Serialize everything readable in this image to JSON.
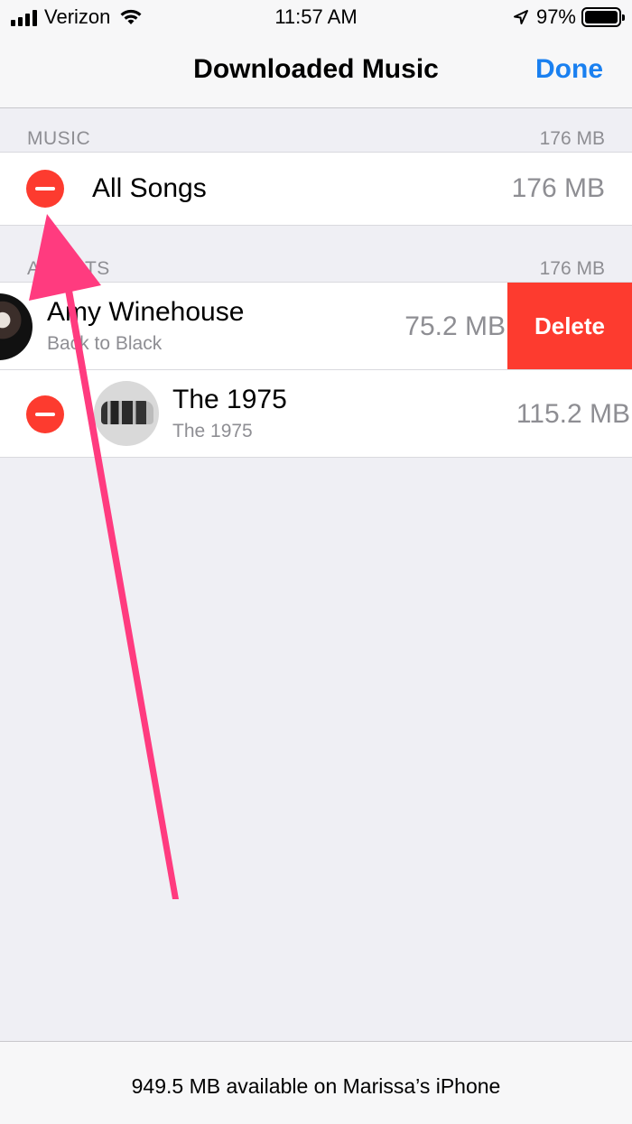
{
  "status_bar": {
    "carrier": "Verizon",
    "time": "11:57 AM",
    "battery_percent": "97%",
    "icons": [
      "cellular-signal-icon",
      "wifi-icon",
      "location-arrow-icon",
      "battery-icon"
    ]
  },
  "nav": {
    "title": "Downloaded Music",
    "done_label": "Done"
  },
  "sections": {
    "music": {
      "header": "MUSIC",
      "header_size": "176 MB",
      "rows": [
        {
          "title": "All Songs",
          "size": "176 MB"
        }
      ]
    },
    "artists": {
      "header": "ARTISTS",
      "header_size": "176 MB",
      "rows": [
        {
          "title": "Amy Winehouse",
          "subtitle": "Back to Black",
          "size": "75.2 MB",
          "action": "Delete"
        },
        {
          "title": "The 1975",
          "subtitle": "The 1975",
          "size": "115.2 MB"
        }
      ]
    }
  },
  "footer": {
    "storage_text": "949.5 MB available on Marissa’s iPhone"
  },
  "colors": {
    "accent": "#1a80f0",
    "destructive": "#fd3b2f",
    "annotation_arrow": "#ff3b7f",
    "background": "#efeff4"
  }
}
